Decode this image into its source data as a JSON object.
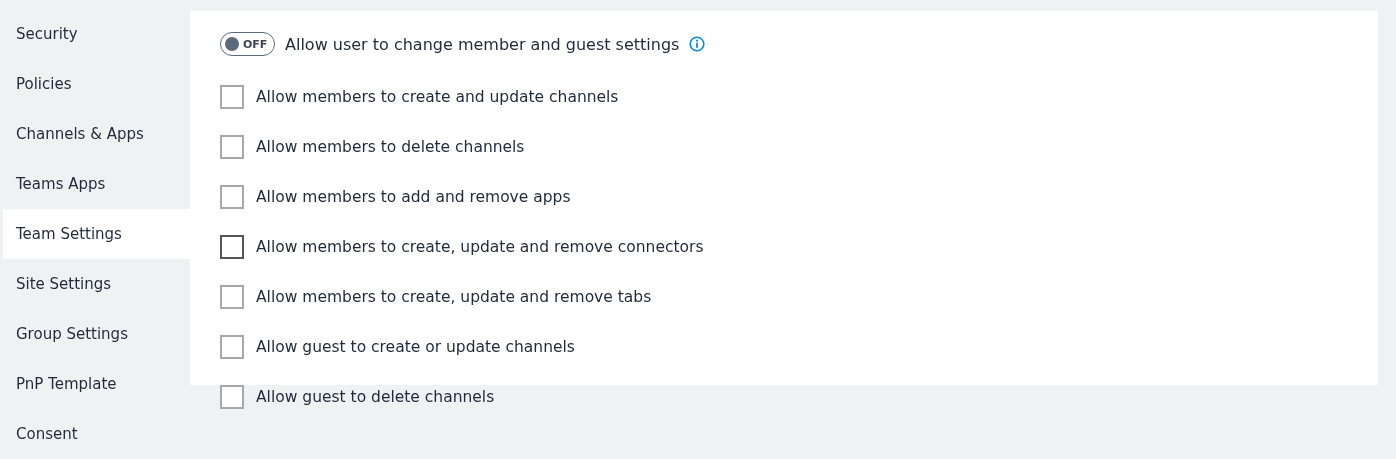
{
  "sidebar": {
    "items": [
      {
        "label": "Security",
        "selected": false
      },
      {
        "label": "Policies",
        "selected": false
      },
      {
        "label": "Channels & Apps",
        "selected": false
      },
      {
        "label": "Teams Apps",
        "selected": false
      },
      {
        "label": "Team Settings",
        "selected": true
      },
      {
        "label": "Site Settings",
        "selected": false
      },
      {
        "label": "Group Settings",
        "selected": false
      },
      {
        "label": "PnP Template",
        "selected": false
      },
      {
        "label": "Consent",
        "selected": false
      }
    ]
  },
  "toggle": {
    "state_label": "OFF",
    "on": false,
    "label": "Allow user to change member and guest settings"
  },
  "options": [
    {
      "label": "Allow members to create and update channels",
      "checked": false,
      "hovered": false
    },
    {
      "label": "Allow members to delete channels",
      "checked": false,
      "hovered": false
    },
    {
      "label": "Allow members to add and remove apps",
      "checked": false,
      "hovered": false
    },
    {
      "label": "Allow members to create, update and remove connectors",
      "checked": false,
      "hovered": true
    },
    {
      "label": "Allow members to create, update and remove tabs",
      "checked": false,
      "hovered": false
    },
    {
      "label": "Allow guest to create or update channels",
      "checked": false,
      "hovered": false
    },
    {
      "label": "Allow guest to delete channels",
      "checked": false,
      "hovered": false
    }
  ]
}
